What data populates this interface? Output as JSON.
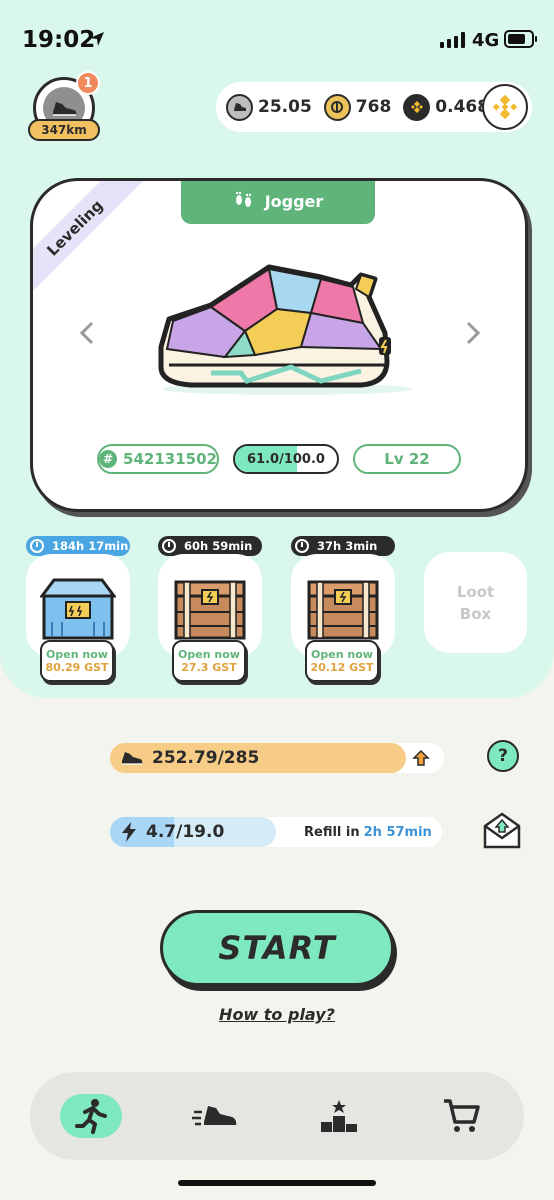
{
  "status_bar": {
    "time": "19:02",
    "network": "4G"
  },
  "profile": {
    "notification_count": "1",
    "distance": "347km"
  },
  "balances": [
    {
      "icon": "gmt-coin-icon",
      "value": "25.05"
    },
    {
      "icon": "gst-coin-icon",
      "value": "768"
    },
    {
      "icon": "bnb-coin-icon",
      "value": "0.468"
    }
  ],
  "sneaker": {
    "status_ribbon": "Leveling",
    "class_label": "Jogger",
    "id": "542131502",
    "durability": "61.0/100.0",
    "durability_fraction": 0.61,
    "level": "Lv 22"
  },
  "mystery_boxes": [
    {
      "timer": "184h 17min",
      "timer_color": "#4aa6e2",
      "action": "Open now",
      "cost": "80.29 GST",
      "chest": "blue"
    },
    {
      "timer": "60h 59min",
      "timer_color": "#2b2b2b",
      "action": "Open now",
      "cost": "27.3 GST",
      "chest": "brown"
    },
    {
      "timer": "37h 3min",
      "timer_color": "#2b2b2b",
      "action": "Open now",
      "cost": "20.12 GST",
      "chest": "brown"
    }
  ],
  "loot_box": {
    "label_line1": "Loot",
    "label_line2": "Box"
  },
  "stamina": {
    "value": "252.79/285",
    "fraction": 0.887
  },
  "energy": {
    "value": "4.7/19.0",
    "fraction": 0.247,
    "refill_label": "Refill in",
    "refill_time": "2h 57min"
  },
  "help_label": "?",
  "start_label": "START",
  "how_to_play": "How to play?",
  "colors": {
    "accent": "#7ee8bf",
    "green": "#5fb47a",
    "gold": "#f3c061",
    "blue": "#4aa6e2"
  }
}
